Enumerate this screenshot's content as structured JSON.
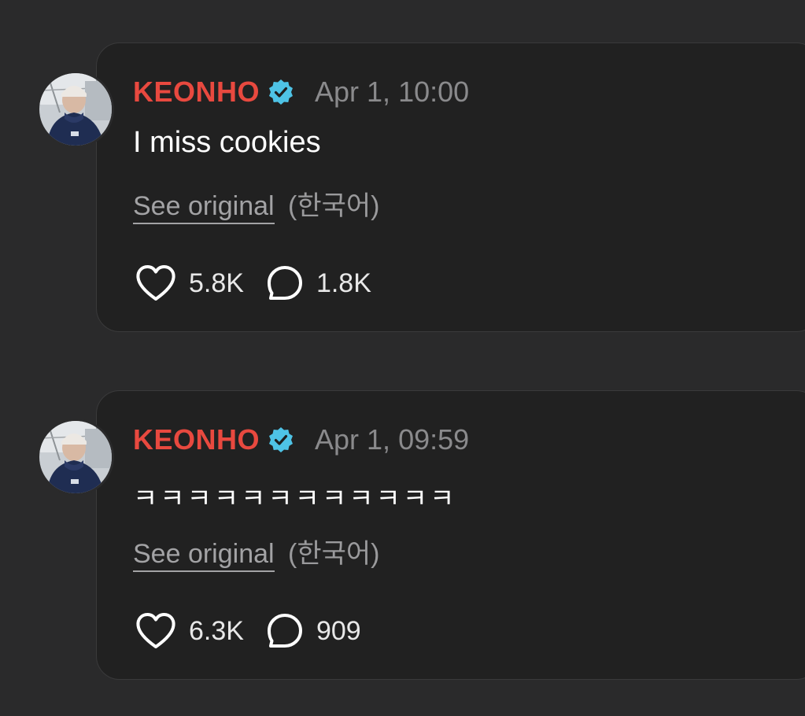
{
  "posts": [
    {
      "username": "KEONHO",
      "verified": true,
      "timestamp": "Apr 1, 10:00",
      "text": "I miss cookies",
      "see_original": "See original",
      "language": "(한국어)",
      "likes": "5.8K",
      "comments": "1.8K"
    },
    {
      "username": "KEONHO",
      "verified": true,
      "timestamp": "Apr 1, 09:59",
      "text": "ㅋㅋㅋㅋㅋㅋㅋㅋㅋㅋㅋㅋ",
      "see_original": "See original",
      "language": "(한국어)",
      "likes": "6.3K",
      "comments": "909"
    }
  ],
  "colors": {
    "background": "#2a2a2b",
    "card": "#212121",
    "username": "#e8493f",
    "verified_badge": "#4ec3e6",
    "muted_text": "#8a8a8c"
  },
  "icons": {
    "avatar": "profile-photo",
    "verified": "verified-badge-icon",
    "like": "heart-icon",
    "comment": "comment-bubble-icon"
  }
}
